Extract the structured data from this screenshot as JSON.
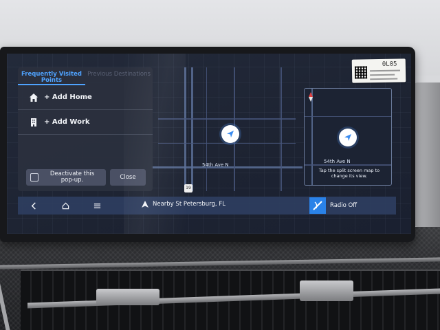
{
  "left_panel": {
    "tabs": [
      {
        "label": "Frequently Visited Points",
        "active": true
      },
      {
        "label": "Previous Destinations",
        "active": false
      }
    ],
    "items": [
      {
        "label": "+ Add Home",
        "icon": "home-icon"
      },
      {
        "label": "+ Add Work",
        "icon": "building-icon"
      }
    ],
    "deactivate_label": "Deactivate this pop-up.",
    "close_label": "Close"
  },
  "map": {
    "street_label_main": "54th Ave N",
    "street_label_split": "54th Ave N",
    "route_shield": "19",
    "split_hint": "Tap the split screen map to change its view."
  },
  "bottom_bar": {
    "back_icon": "back-chevron-icon",
    "home_icon": "home-outline-icon",
    "menu_icon": "menu-icon",
    "nearby_text": "Nearby St Petersburg, FL",
    "radio_label": "Radio Off",
    "radio_icon": "radio-icon"
  },
  "sticker": {
    "code": "0L05"
  },
  "colors": {
    "accent": "#4fa3ff",
    "panel": "#2b303e",
    "bottom_bar": "#2e3e60",
    "radio": "#2a82e8"
  }
}
